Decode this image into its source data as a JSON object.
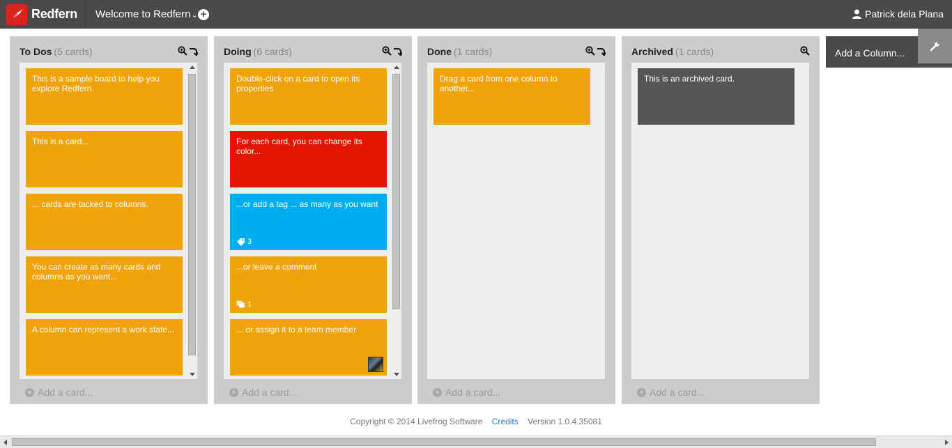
{
  "app": {
    "name": "Redfern"
  },
  "header": {
    "board_menu_label": "Welcome to Redfern",
    "board_menu_caret": "⌄",
    "add_board_symbol": "+",
    "user_name": "Patrick dela Plana"
  },
  "columns": [
    {
      "title": "To Dos",
      "count": "(5 cards)",
      "add_card": "Add a card...",
      "cards": [
        {
          "text": "This is a sample board to help you explore Redfern.",
          "color": "#f0a30a"
        },
        {
          "text": "This is a card...",
          "color": "#f0a30a"
        },
        {
          "text": "... cards are tacked to columns.",
          "color": "#f0a30a"
        },
        {
          "text": "You can create as many cards and columns as you want...",
          "color": "#f0a30a"
        },
        {
          "text": "A column can represent a work state...",
          "color": "#f0a30a"
        }
      ]
    },
    {
      "title": "Doing",
      "count": "(6 cards)",
      "add_card": "Add a card...",
      "cards": [
        {
          "text": "Double-click on a card to open its properties",
          "color": "#f0a30a"
        },
        {
          "text": "For each card, you can change its color...",
          "color": "#e51400"
        },
        {
          "text": "...or add a tag ... as many as you want",
          "color": "#00adef",
          "tag_count": "3"
        },
        {
          "text": "...or leave a comment",
          "color": "#f0a30a",
          "comment_count": "1"
        },
        {
          "text": "... or assign it to a team member",
          "color": "#f0a30a"
        }
      ]
    },
    {
      "title": "Done",
      "count": "(1 cards)",
      "add_card": "Add a card...",
      "cards": [
        {
          "text": "Drag a card from one column to another...",
          "color": "#f0a30a"
        }
      ]
    },
    {
      "title": "Archived",
      "count": "(1 cards)",
      "add_card": "Add a card...",
      "cards": [
        {
          "text": "This is an archived card.",
          "color": "#555555"
        }
      ]
    }
  ],
  "add_column": {
    "label": "Add a Column..."
  },
  "footer": {
    "copyright": "Copyright © 2014 Livefrog Software",
    "credits": "Credits",
    "version": "Version 1.0.4.35081"
  },
  "icons": {
    "logo": "redfern-feather-icon",
    "user": "user-icon",
    "zoom": "zoom-icon",
    "collapse": "collapse-arrow-icon",
    "tag": "tag-icon",
    "comment": "comment-icon",
    "settings": "wrench-icon"
  }
}
